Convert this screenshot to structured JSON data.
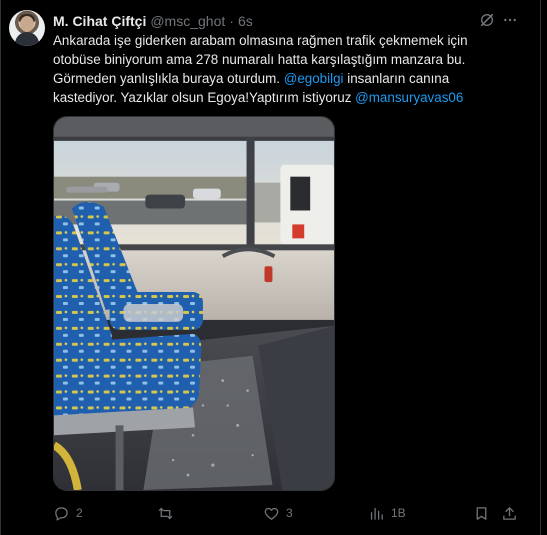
{
  "tweet": {
    "author_name": "M. Cihat Çiftçi",
    "handle": "@msc_ghot",
    "separator": "·",
    "time": "6s",
    "text_part1": "Ankarada işe giderken arabam olmasına rağmen trafik çekmemek için otobüse biniyorum ama 278 numaralı hatta karşılaştığım manzara bu. Görmeden yanlışlıkla buraya oturdum. ",
    "mention1": "@egobilgi",
    "text_part2": " insanların canına kastediyor. Yazıklar olsun Egoya!Yaptırım istiyoruz ",
    "mention2": "@mansuryavas06",
    "accent_color": "#1d9bf0"
  },
  "actions": {
    "reply_count": "2",
    "retweet_count": "",
    "like_count": "3",
    "views_count": "1B"
  },
  "icons": {
    "grok": "grok-icon",
    "more": "more-icon",
    "reply": "reply-icon",
    "retweet": "retweet-icon",
    "like": "heart-icon",
    "views": "views-icon",
    "bookmark": "bookmark-icon",
    "share": "share-icon"
  }
}
